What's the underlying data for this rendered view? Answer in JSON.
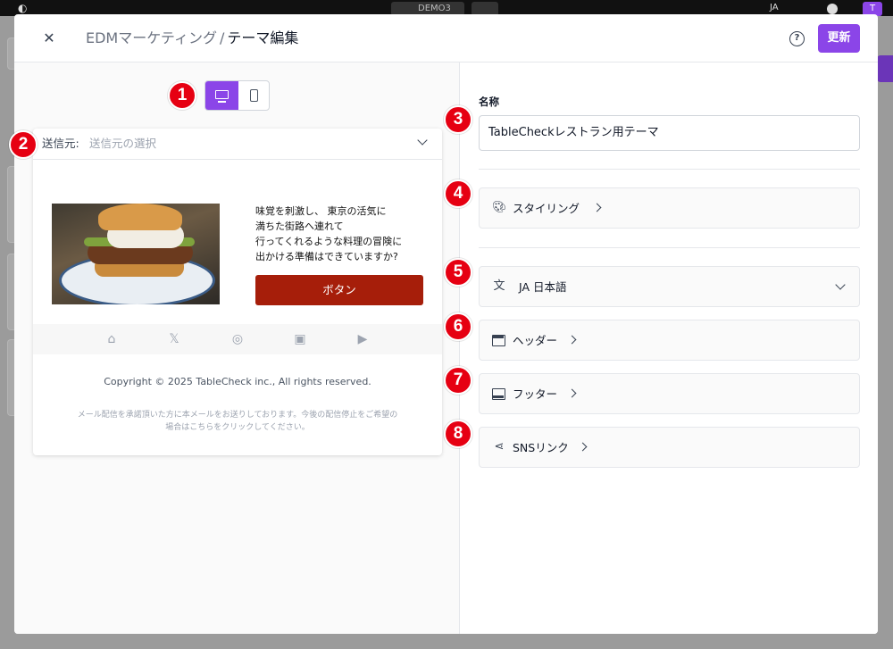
{
  "background_app": {
    "chip_label": "DEMO3",
    "lang": "JA",
    "avatar": "T"
  },
  "header": {
    "breadcrumb": "EDMマーケティング",
    "separator": "/",
    "title": "テーマ編集",
    "help_icon": "?",
    "update_label": "更新"
  },
  "preview": {
    "sender_label": "送信元:",
    "sender_placeholder": "送信元の選択",
    "hero_text_lines": [
      "味覚を刺激し、 東京の活気に",
      "満ちた街路へ連れて",
      "行ってくれるような料理の冒険に",
      "出かける準備はできていますか?"
    ],
    "button_label": "ボタン",
    "social_icons": [
      "home-icon",
      "x-icon",
      "instagram-icon",
      "line-icon",
      "youtube-icon"
    ],
    "copyright": "Copyright © 2025 TableCheck inc., All rights reserved.",
    "disclaimer_line1": "メール配信を承諾頂いた方に本メールをお送りしております。今後の配信停止をご希望の",
    "disclaimer_line2": "場合はこちらをクリックしてください。"
  },
  "form": {
    "name_label": "名称",
    "name_value": "TableCheckレストラン用テーマ",
    "styling_label": "スタイリング",
    "language_label": "JA 日本語",
    "header_label": "ヘッダー",
    "footer_label": "フッター",
    "sns_label": "SNSリンク"
  },
  "badges": [
    "1",
    "2",
    "3",
    "4",
    "5",
    "6",
    "7",
    "8"
  ],
  "colors": {
    "accent": "#8b45e8",
    "button": "#a61e0a",
    "badge": "#e60012"
  }
}
